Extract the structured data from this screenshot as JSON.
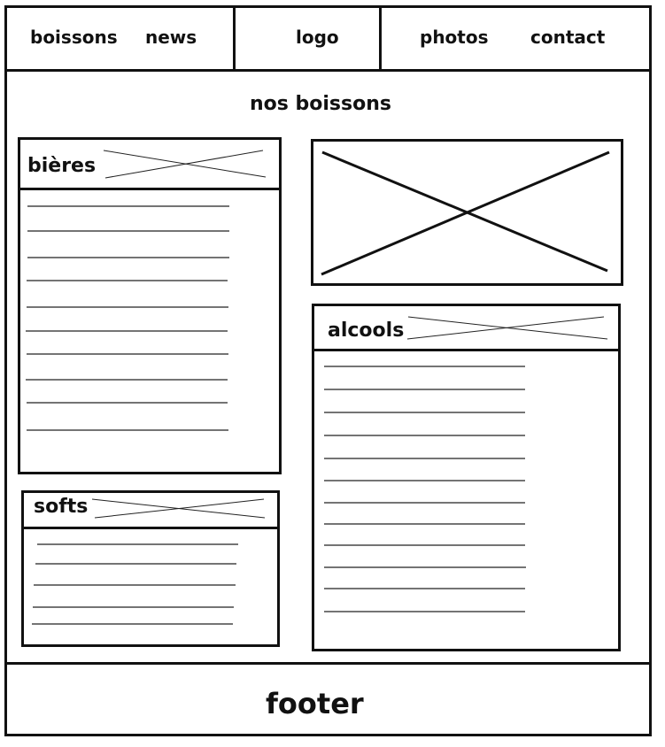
{
  "nav": {
    "items": [
      "boissons",
      "news",
      "logo",
      "photos",
      "contact"
    ]
  },
  "page_title": "nos boissons",
  "sections": {
    "bieres": {
      "title": "bières",
      "line_count": 10
    },
    "alcools": {
      "title": "alcools",
      "line_count": 12
    },
    "softs": {
      "title": "softs",
      "line_count": 5
    }
  },
  "footer": {
    "label": "footer"
  },
  "placeholder_image": {
    "icon": "image-placeholder-icon"
  }
}
